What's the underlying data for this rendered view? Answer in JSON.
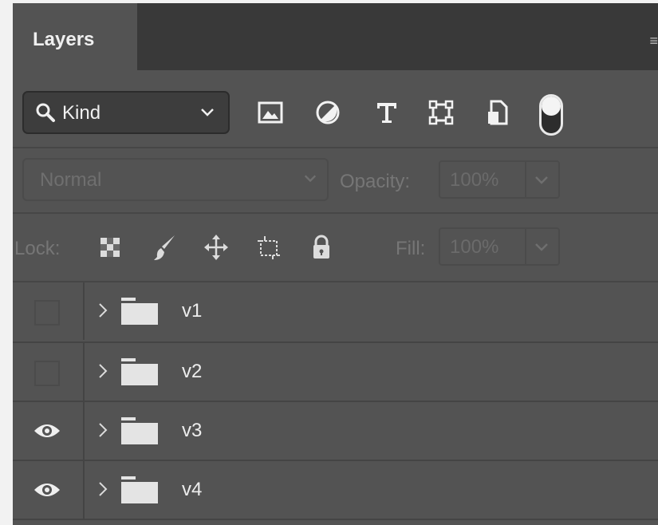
{
  "panel": {
    "tab_label": "Layers",
    "menu_icon": "panel-menu-icon"
  },
  "filter": {
    "kind_label": "Kind",
    "icons": [
      "pixel-layer-filter-icon",
      "adjustment-layer-filter-icon",
      "type-layer-filter-icon",
      "shape-layer-filter-icon",
      "smart-object-filter-icon"
    ],
    "toggle_on": true
  },
  "blend": {
    "mode": "Normal",
    "opacity_label": "Opacity:",
    "opacity_value": "100%"
  },
  "lock": {
    "label": "Lock:",
    "icons": [
      "lock-transparent-pixels-icon",
      "lock-image-pixels-icon",
      "lock-position-icon",
      "lock-artboard-icon",
      "lock-all-icon"
    ],
    "fill_label": "Fill:",
    "fill_value": "100%"
  },
  "layers": [
    {
      "name": "v1",
      "visible": false
    },
    {
      "name": "v2",
      "visible": false
    },
    {
      "name": "v3",
      "visible": true
    },
    {
      "name": "v4",
      "visible": true
    }
  ],
  "colors": {
    "panel_bg": "#535353",
    "tabbar_bg": "#393939",
    "text": "#ededed",
    "disabled_text": "#767676"
  }
}
